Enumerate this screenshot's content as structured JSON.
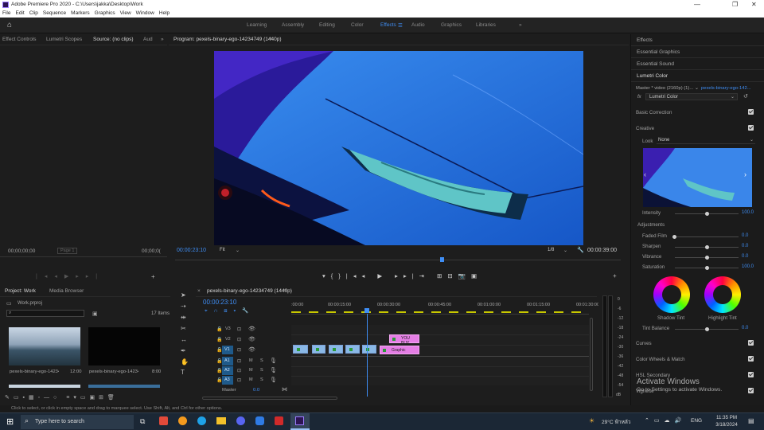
{
  "window": {
    "title": "Adobe Premiere Pro 2020 - C:\\Users\\jakka\\Desktop\\Work"
  },
  "menu": [
    "File",
    "Edit",
    "Clip",
    "Sequence",
    "Markers",
    "Graphics",
    "View",
    "Window",
    "Help"
  ],
  "workspaces": [
    "Learning",
    "Assembly",
    "Editing",
    "Color",
    "Effects",
    "Audio",
    "Graphics",
    "Libraries"
  ],
  "active_workspace": "Effects",
  "source_panel": {
    "tabs": [
      "Effect Controls",
      "Lumetri Scopes",
      "Source: (no clips)",
      "Aud"
    ],
    "timecode_left": "00;00;00;00",
    "page_label": "Page 1",
    "timecode_right": "00;00;0("
  },
  "program_panel": {
    "title": "Program: pexels-binary-ego-14234749 (1440p)",
    "timecode": "00:00:23:10",
    "fit": "Fit",
    "resolution": "1/8",
    "duration": "00:00:39:00"
  },
  "project_panel": {
    "tabs": [
      "Project: Work",
      "Media Browser"
    ],
    "file": "Work.prproj",
    "item_count": "17 Items",
    "clips": [
      {
        "name": "pexels-binary-ego-1423474...",
        "dur": "12:00"
      },
      {
        "name": "pexels-binary-ego-1423474...",
        "dur": "8:00"
      }
    ]
  },
  "timeline": {
    "title": "pexels-binary-ego-14234749 (1440p)",
    "timecode": "00:00:23:10",
    "ruler": [
      ":00:00",
      "00:00:15:00",
      "00:00:30:00",
      "00:00:45:00",
      "00:01:00:00",
      "00:01:15:00",
      "00:01:30:00"
    ],
    "tracks_video": [
      "V3",
      "V2",
      "V1"
    ],
    "tracks_audio": [
      "A1",
      "A2",
      "A3"
    ],
    "master_label": "Master",
    "master_value": "0.0",
    "clip_v3": "YOU BUY",
    "clip_v2": "Graphic"
  },
  "meters": [
    "0",
    "-6",
    "-12",
    "-18",
    "-24",
    "-30",
    "-36",
    "-42",
    "-48",
    "-54",
    "dB"
  ],
  "right_panel": {
    "sections": [
      "Effects",
      "Essential Graphics",
      "Essential Sound",
      "Lumetri Color"
    ],
    "master_label": "Master * video (2160p) (1)...",
    "master_link": "pexels-binary-ego-142...",
    "fx_label": "fx",
    "fx_value": "Lumetri Color",
    "basic_correction": "Basic Correction",
    "creative": "Creative",
    "look_label": "Look",
    "look_value": "None",
    "intensity": {
      "label": "Intensity",
      "value": "100.0"
    },
    "adjustments": "Adjustments",
    "faded_film": {
      "label": "Faded Film",
      "value": "0.0"
    },
    "sharpen": {
      "label": "Sharpen",
      "value": "0.0"
    },
    "vibrance": {
      "label": "Vibrance",
      "value": "0.0"
    },
    "saturation": {
      "label": "Saturation",
      "value": "100.0"
    },
    "shadow_tint": "Shadow Tint",
    "highlight_tint": "Highlight Tint",
    "tint_balance": {
      "label": "Tint Balance",
      "value": "0.0"
    },
    "curves": "Curves",
    "color_wheels": "Color Wheels & Match",
    "hsl": "HSL Secondary",
    "vignette": "Vignette"
  },
  "activate": {
    "title": "Activate Windows",
    "sub": "Go to Settings to activate Windows."
  },
  "status_text": "Click to select, or click in empty space and drag to marquee select. Use Shift, Alt, and Ctrl for other options.",
  "taskbar": {
    "search": "Type here to search",
    "weather": "29°C ฟ้าหลัว",
    "lang": "ENG",
    "time": "11:35 PM",
    "date": "3/18/2024"
  },
  "colors": {
    "accent": "#3f8ef5",
    "clip_video": "#8ab8e6",
    "clip_graphic": "#e57ee5",
    "timeline_playhead": "#3f8ef5"
  }
}
